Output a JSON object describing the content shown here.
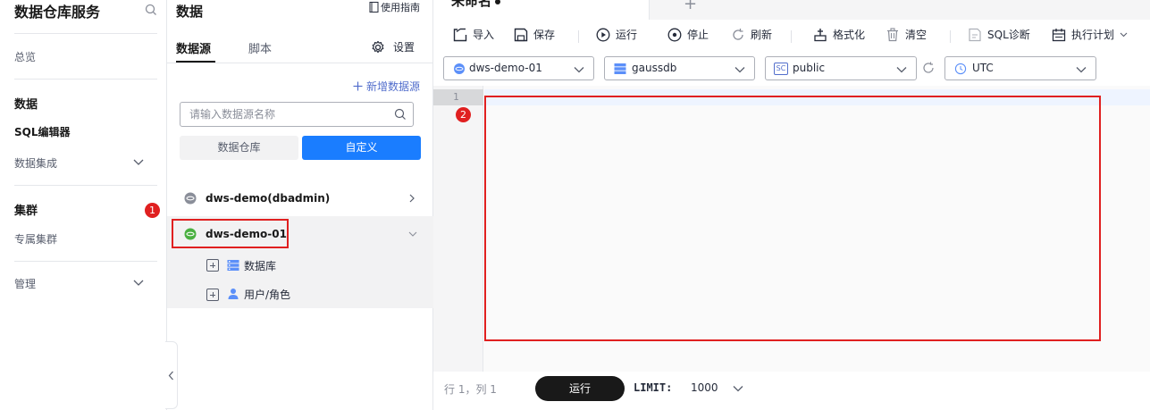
{
  "app": {
    "title": "数据仓库服务"
  },
  "leftnav": {
    "overview": "总览",
    "data_group": "数据",
    "sql_editor": "SQL编辑器",
    "data_integration": "数据集成",
    "cluster_group": "集群",
    "dedicated_cluster": "专属集群",
    "manage": "管理"
  },
  "badges": {
    "one": "1",
    "two": "2"
  },
  "panel": {
    "title": "数据",
    "guide": "使用指南",
    "tabs": [
      "数据源",
      "脚本"
    ],
    "settings": "设置",
    "add_datasource": "新增数据源",
    "search_placeholder": "请输入数据源名称",
    "segments": [
      "数据仓库",
      "自定义"
    ],
    "datasources": [
      {
        "name": "dws-demo(dbadmin)",
        "expanded": false
      },
      {
        "name": "dws-demo-01",
        "expanded": true
      }
    ],
    "children": [
      "数据库",
      "用户/角色"
    ]
  },
  "editor": {
    "tab_name": "未命名",
    "toolbar": {
      "import": "导入",
      "save": "保存",
      "run": "运行",
      "stop": "停止",
      "refresh": "刷新",
      "format": "格式化",
      "clear": "清空",
      "sql_diagnose": "SQL诊断",
      "exec_plan": "执行计划"
    },
    "selects": {
      "datasource": "dws-demo-01",
      "database": "gaussdb",
      "schema": "public",
      "schema_badge": "SC",
      "timezone": "UTC"
    },
    "line_number": "1",
    "status": {
      "cursor": "行 1，列 1",
      "run": "运行",
      "limit_label": "LIMIT:",
      "limit_value": "1000"
    }
  },
  "colors": {
    "accent": "#1a7dff",
    "highlight": "#e02020",
    "ds_active": "#4ab041"
  }
}
